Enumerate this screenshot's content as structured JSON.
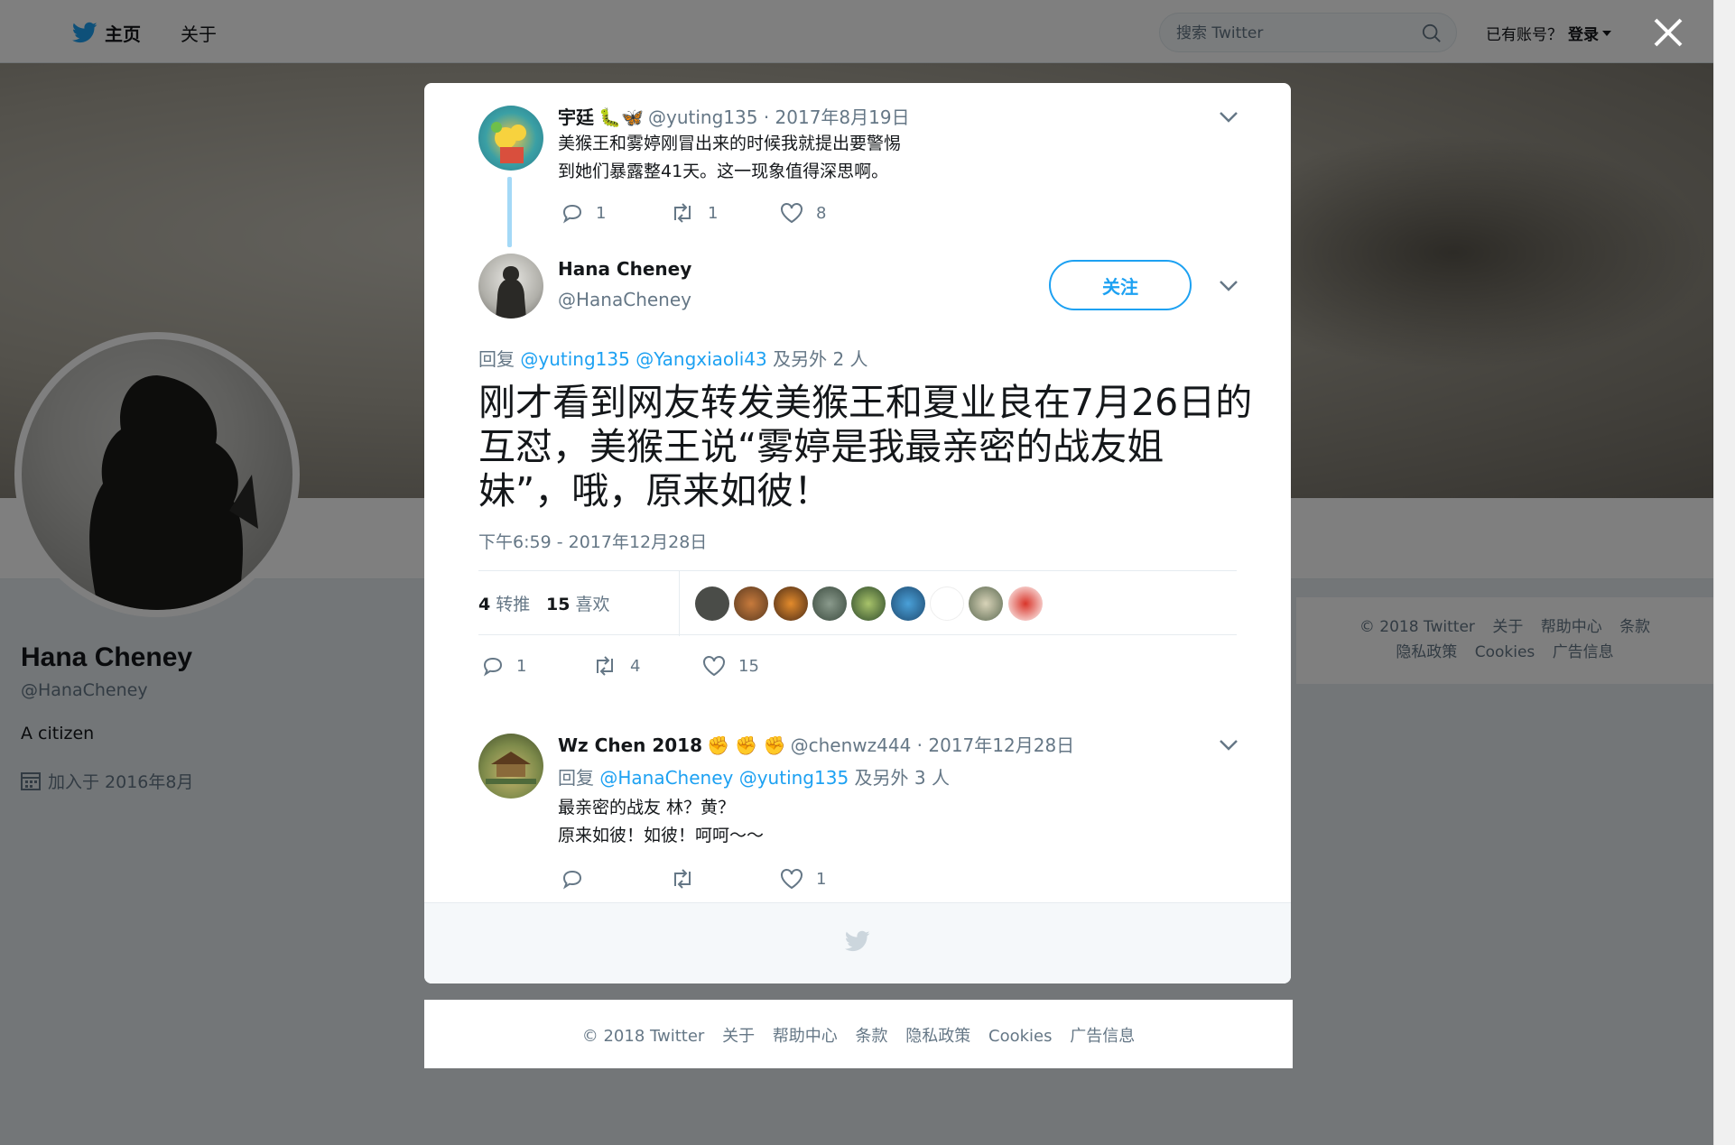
{
  "topbar": {
    "home_label": "主页",
    "about_label": "关于",
    "search_placeholder": "搜索 Twitter",
    "have_account": "已有账号？",
    "login_label": "登录"
  },
  "profile": {
    "name": "Hana Cheney",
    "handle": "@HanaCheney",
    "bio": "A citizen",
    "joined": "加入于 2016年8月"
  },
  "side_footer": {
    "line1": [
      "© 2018 Twitter",
      "关于",
      "帮助中心",
      "条款"
    ],
    "line2": [
      "隐私政策",
      "Cookies",
      "广告信息"
    ]
  },
  "modal": {
    "parent_tweet": {
      "name": "宇廷",
      "handle_date": "@yuting135 · 2017年8月19日",
      "text_line1": "美猴王和雾婷刚冒出来的时候我就提出要警惕",
      "text_line2": "到她们暴露整41天。这一现象值得深思啊。",
      "replies": "1",
      "retweets": "1",
      "likes": "8"
    },
    "main_tweet": {
      "name": "Hana Cheney",
      "handle": "@HanaCheney",
      "follow_label": "关注",
      "reply_prefix": "回复",
      "reply_mention1": "@yuting135",
      "reply_mention2": "@Yangxiaoli43",
      "reply_suffix": "及另外 2 人",
      "text": "刚才看到网友转发美猴王和夏业良在7月26日的互怼，美猴王说“雾婷是我最亲密的战友姐妹”，哦，原来如彼！",
      "timestamp": "下午6:59 - 2017年12月28日",
      "retweet_count": "4",
      "retweet_label": "转推",
      "like_count": "15",
      "like_label": "喜欢",
      "replies": "1",
      "retweets": "4",
      "likes": "15"
    },
    "reply_tweet": {
      "name": "Wz Chen 2018",
      "emoji": "✊ ✊ ✊",
      "handle_date": "@chenwz444 · 2017年12月28日",
      "reply_prefix": "回复",
      "reply_mention1": "@HanaCheney",
      "reply_mention2": "@yuting135",
      "reply_suffix": "及另外 3 人",
      "text_line1": "最亲密的战友 林？黄？",
      "text_line2": "原来如彼！如彼！呵呵～～",
      "likes": "1"
    }
  },
  "page_footer": [
    "© 2018 Twitter",
    "关于",
    "帮助中心",
    "条款",
    "隐私政策",
    "Cookies",
    "广告信息"
  ],
  "colors": {
    "accent": "#1da1f2",
    "text": "#14171a",
    "muted": "#657786",
    "thread": "#a4d9f7"
  }
}
